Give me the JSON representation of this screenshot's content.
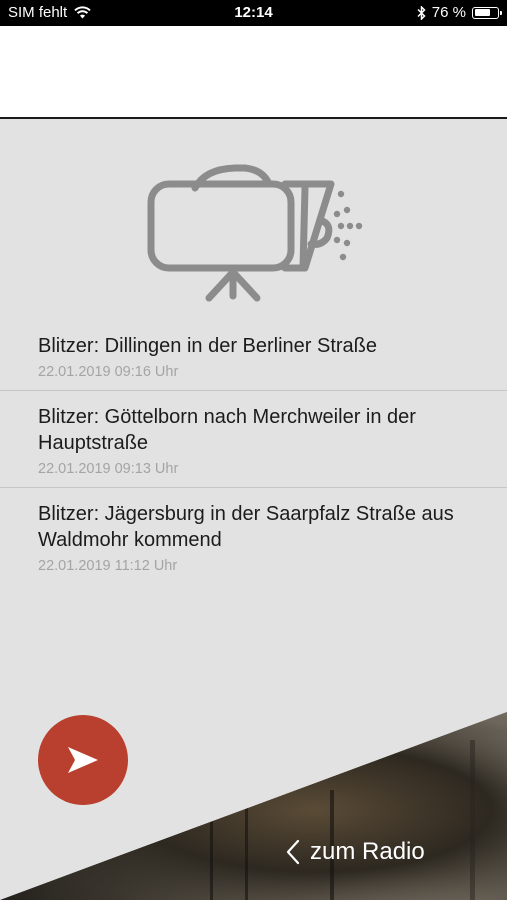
{
  "status_bar": {
    "carrier": "SIM fehlt",
    "time": "12:14",
    "battery_percent": "76 %",
    "battery_level": 0.76,
    "icons": [
      "wifi-icon",
      "bluetooth-icon",
      "battery-icon"
    ]
  },
  "hero_icon": "speed-camera-icon",
  "news": [
    {
      "title": "Blitzer: Dillingen in der Berliner Straße",
      "date": "22.01.2019 09:16 Uhr"
    },
    {
      "title": "Blitzer: Göttelborn nach Merchweiler in der Hauptstraße",
      "date": "22.01.2019 09:13 Uhr"
    },
    {
      "title": "Blitzer: Jägersburg in der Saarpfalz Straße aus Waldmohr kommend",
      "date": "22.01.2019 11:12 Uhr"
    }
  ],
  "footer": {
    "back_label": "zum Radio",
    "play_icon": "play-icon",
    "accent_color": "#b9402e"
  }
}
